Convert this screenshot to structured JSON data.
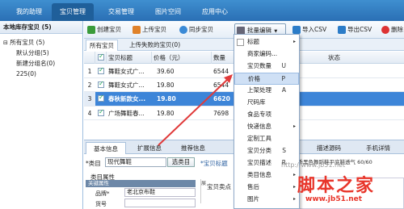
{
  "nav": {
    "tabs": [
      "我的助理",
      "宝贝管理",
      "交易管理",
      "图片空间",
      "应用中心"
    ]
  },
  "sidebar": {
    "header": "本地库存宝贝 (5)",
    "items": [
      {
        "label": "所有宝贝 (5)",
        "expander": "⊟"
      },
      {
        "label": "默认分组(5)"
      },
      {
        "label": "新建分组名(0)"
      },
      {
        "label": "225(0)"
      }
    ]
  },
  "toolbar": {
    "create": "创建宝贝",
    "upload": "上传宝贝",
    "sync": "同步宝贝",
    "batch": "批量编辑",
    "import": "导入CSV",
    "export": "导出CSV",
    "delete": "删除宝"
  },
  "subtabs": [
    "所有宝贝",
    "上传失败的宝贝(0)"
  ],
  "table": {
    "headers": [
      "宝贝标题",
      "价格（元）",
      "数量",
      "状态"
    ],
    "rows": [
      {
        "num": "1",
        "checked": true,
        "title": "舞鞋女式广...",
        "price": "39.60",
        "qty": "6544"
      },
      {
        "num": "2",
        "checked": true,
        "title": "舞鞋女式广...",
        "price": "19.80",
        "qty": "6544"
      },
      {
        "num": "3",
        "checked": true,
        "title": "春秋新款女...",
        "price": "19.80",
        "qty": "6620",
        "selected": true
      },
      {
        "num": "4",
        "checked": true,
        "title": "广场舞鞋春...",
        "price": "19.80",
        "qty": "7698"
      }
    ]
  },
  "menu": {
    "items": [
      {
        "label": "标题",
        "arrow": "▸"
      },
      {
        "label": "商家编码..."
      },
      {
        "label": "宝贝数量",
        "key": "U"
      },
      {
        "label": "价格",
        "key": "P",
        "highlighted": true
      },
      {
        "label": "上架处理",
        "key": "A"
      },
      {
        "label": "尺码库"
      },
      {
        "label": "食品专项"
      },
      {
        "label": "快递信息",
        "arrow": "▸"
      },
      {
        "label": "定制工具"
      },
      {
        "label": "宝贝分类",
        "key": "S"
      },
      {
        "label": "宝贝描述",
        "key": "R"
      },
      {
        "label": "类目信息",
        "arrow": "▸"
      },
      {
        "label": "售后",
        "arrow": "▸"
      },
      {
        "label": "图片",
        "arrow": "▸"
      }
    ]
  },
  "detail": {
    "tabs": [
      "基本信息",
      "扩展信息",
      "推荐信息",
      "描述源码",
      "手机详情"
    ],
    "category_label": "*类目",
    "category_value": "现代舞鞋",
    "category_button": "选类目",
    "title_label": "*宝贝标题",
    "title_value": "秋季黑色舞蹈鞋平底鞋透气 60/60",
    "attrs_label": "类目属性",
    "key_attrs": "关键属性",
    "brand_label": "品牌*",
    "brand_value": "老北京布鞋",
    "model_label": "货号",
    "selling_point": "宝贝卖点",
    "expand": "展"
  },
  "watermark": {
    "big": "脚本之家",
    "small": "www.jb51.net",
    "url": "http://www.jb51.net"
  },
  "colors": {
    "accent": "#2a6fb4",
    "selected_row": "#3d85d8",
    "arrow": "#e03a3a",
    "watermark": "#e8352a"
  }
}
